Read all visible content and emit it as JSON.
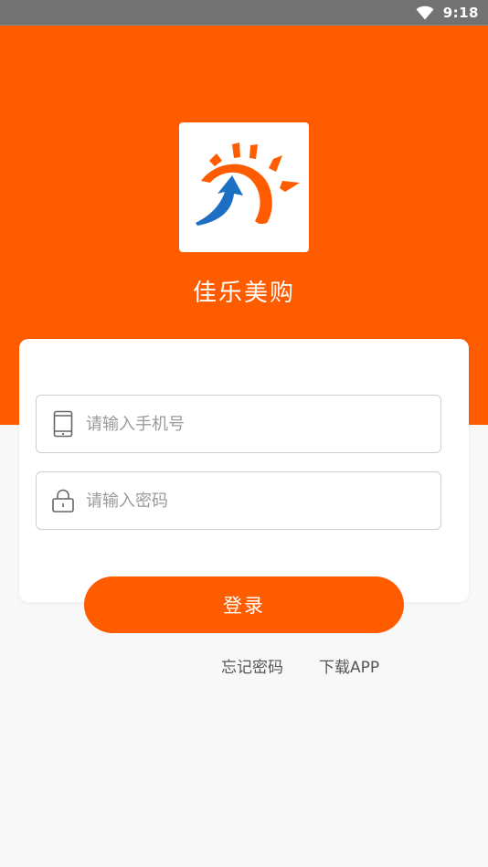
{
  "status_bar": {
    "time": "9:18",
    "wifi_icon": "wifi-icon"
  },
  "app": {
    "name": "佳乐美购",
    "logo_icon": "logo-sun-arrow-icon",
    "brand_color": "#ff5c00",
    "logo_blue": "#1d6fc4"
  },
  "form": {
    "phone": {
      "placeholder": "请输入手机号",
      "value": "",
      "icon": "phone-icon"
    },
    "password": {
      "placeholder": "请输入密码",
      "value": "",
      "icon": "lock-icon"
    },
    "login_label": "登录"
  },
  "links": {
    "forgot_password": "忘记密码",
    "download_app": "下载APP"
  }
}
